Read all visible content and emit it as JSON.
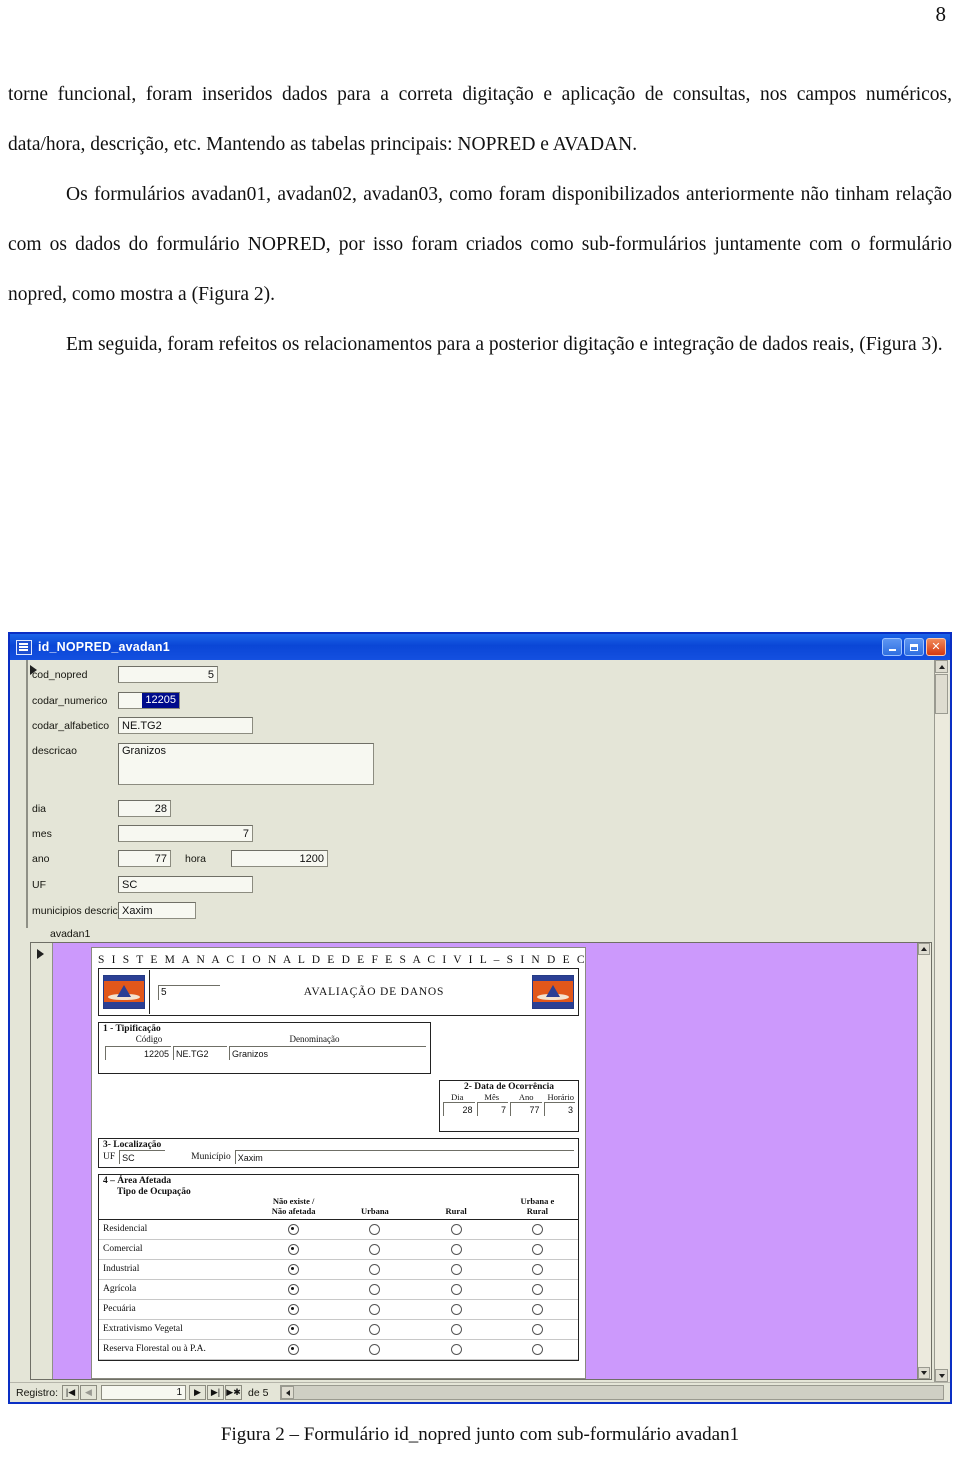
{
  "page_number": "8",
  "document": {
    "paragraphs": [
      "torne funcional, foram inseridos dados para a correta digitação e aplicação de consultas, nos campos numéricos, data/hora, descrição, etc. Mantendo as tabelas principais: NOPRED e AVADAN.",
      "Os formulários avadan01, avadan02, avadan03, como foram disponibilizados anteriormente não tinham relação com os dados do formulário NOPRED, por isso foram criados como sub-formulários juntamente com o formulário nopred, como mostra a (Figura 2).",
      "Em seguida, foram refeitos os relacionamentos para a posterior digitação e integração de dados reais, (Figura 3)."
    ],
    "figure_caption": "Figura 2 – Formulário id_nopred junto com sub-formulário avadan1"
  },
  "window": {
    "title": "id_NOPRED_avadan1",
    "icon": "access-form-icon",
    "controls": {
      "minimize": "_",
      "maximize": "□",
      "close": "✕"
    }
  },
  "main_form": {
    "fields": [
      {
        "label": "cod_nopred",
        "value": "5",
        "type": "number"
      },
      {
        "label": "codar_numerico",
        "value": "12205",
        "type": "selected"
      },
      {
        "label": "codar_alfabetico",
        "value": "NE.TG2",
        "type": "text"
      },
      {
        "label": "descricao",
        "value": "Granizos",
        "type": "memo"
      },
      {
        "label": "dia",
        "value": "28",
        "type": "number"
      },
      {
        "label": "mes",
        "value": "7",
        "type": "number"
      },
      {
        "label": "ano",
        "value": "77",
        "type": "number"
      },
      {
        "label": "hora",
        "value": "1200",
        "type": "number"
      },
      {
        "label": "UF",
        "value": "SC",
        "type": "text"
      },
      {
        "label": "municipios descricao",
        "value": "Xaxim",
        "type": "text"
      }
    ]
  },
  "subform": {
    "tab_label": "avadan1",
    "background_color": "#cc99fc",
    "header": {
      "system_title": "S I S T E M A   N A C I O N A L   D E   D E F E S A   C I V I L – S I N D E C",
      "id_value": "5",
      "form_title": "AVALIAÇÃO DE DANOS",
      "logo_left": "civil-defense-logo",
      "logo_right": "civil-defense-logo"
    },
    "section1": {
      "title": "1 - Tipificação",
      "head_codigo": "Código",
      "head_denominacao": "Denominação",
      "codigo": "12205",
      "codigo_alpha": "NE.TG2",
      "denominacao": "Granizos"
    },
    "section2": {
      "title": "2- Data de Ocorrência",
      "heads": [
        "Dia",
        "Mês",
        "Ano",
        "Horário"
      ],
      "values": [
        "28",
        "7",
        "77",
        "3"
      ]
    },
    "section3": {
      "title": "3- Localização",
      "uf_label": "UF",
      "uf_value": "SC",
      "municipio_label": "Município",
      "municipio_value": "Xaxim"
    },
    "section4": {
      "title": "4 – Área Afetada",
      "subtitle": "Tipo de Ocupação",
      "columns": [
        "Não existe /\nNão afetada",
        "Urbana",
        "Rural",
        "Urbana e\nRural"
      ],
      "column_labels": [
        {
          "line1": "Não existe /",
          "line2": "Não afetada"
        },
        {
          "line1": "Urbana",
          "line2": ""
        },
        {
          "line1": "Rural",
          "line2": ""
        },
        {
          "line1": "Urbana e",
          "line2": "Rural"
        }
      ],
      "rows": [
        {
          "label": "Residencial",
          "selected": 0
        },
        {
          "label": "Comercial",
          "selected": 0
        },
        {
          "label": "Industrial",
          "selected": 0
        },
        {
          "label": "Agrícola",
          "selected": 0
        },
        {
          "label": "Pecuária",
          "selected": 0
        },
        {
          "label": "Extrativismo Vegetal",
          "selected": 0
        },
        {
          "label": "Reserva Florestal ou à P.A.",
          "selected": 0
        }
      ]
    }
  },
  "navigation": {
    "label": "Registro:",
    "first": "|◀",
    "previous": "◀",
    "current": "1",
    "next": "▶",
    "last": "▶|",
    "new": "▶✱",
    "of_label": "de 5"
  }
}
